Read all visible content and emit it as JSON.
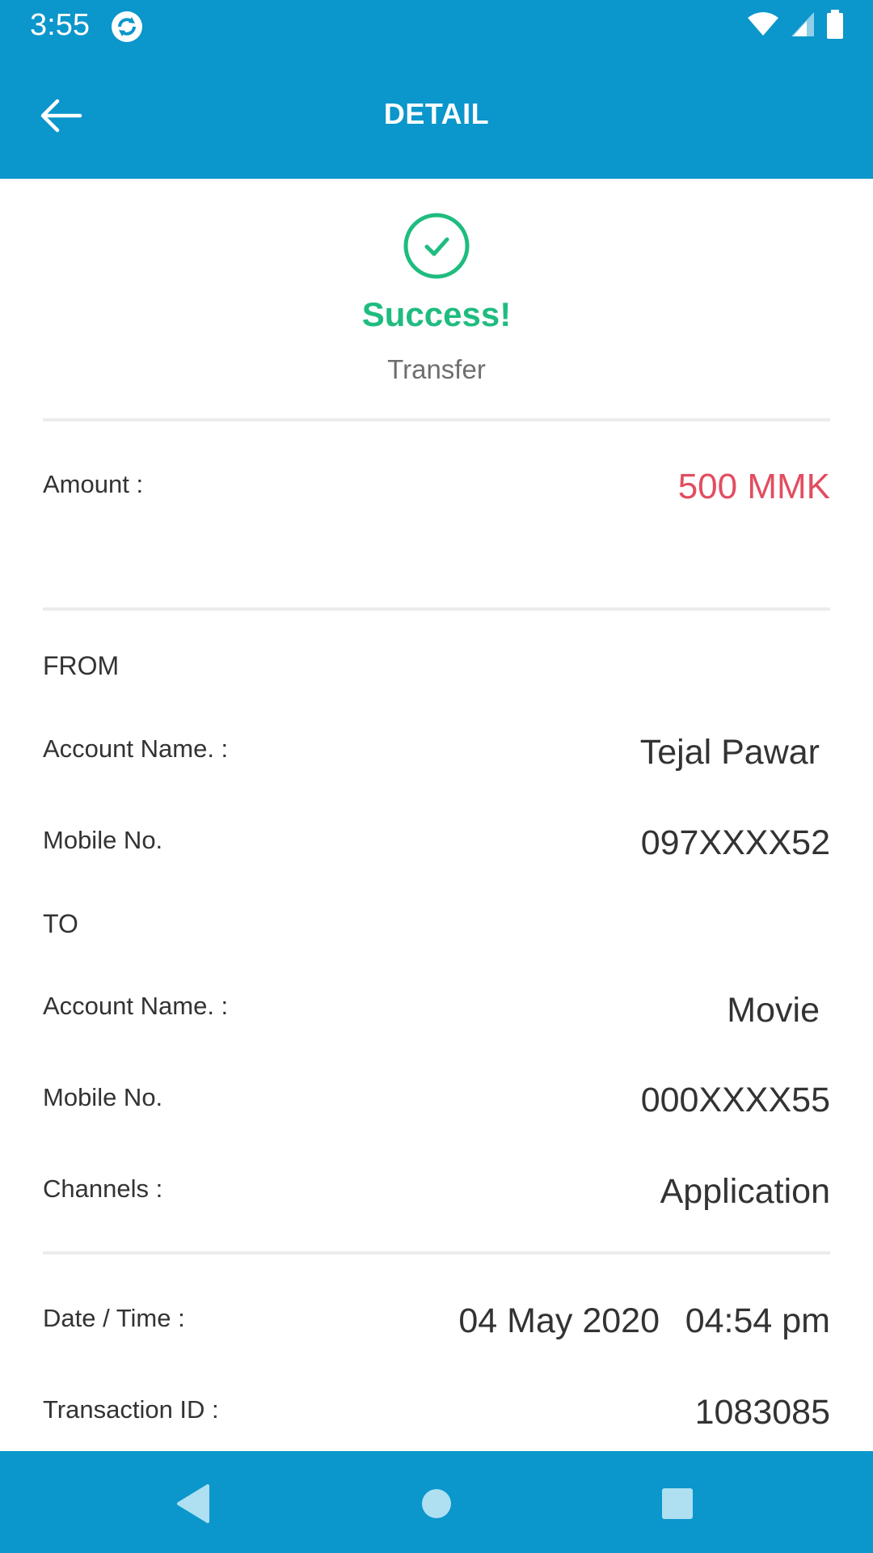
{
  "status_bar": {
    "time": "3:55",
    "icons": [
      "app-sync-icon",
      "wifi-icon",
      "signal-icon",
      "battery-icon"
    ]
  },
  "app_bar": {
    "back_icon": "arrow-left-icon",
    "title": "DETAIL"
  },
  "result": {
    "icon": "check-circle-icon",
    "title": "Success!",
    "subtitle": "Transfer"
  },
  "amount": {
    "label": "Amount :",
    "value": "500 MMK"
  },
  "from": {
    "heading": "FROM",
    "account_name_label": "Account Name. :",
    "account_name_value": "Tejal Pawar",
    "mobile_label": "Mobile No.",
    "mobile_value": "097XXXX52"
  },
  "to": {
    "heading": "TO",
    "account_name_label": "Account Name. :",
    "account_name_value": "Movie",
    "mobile_label": "Mobile No.",
    "mobile_value": "000XXXX55"
  },
  "channels": {
    "label": "Channels :",
    "value": "Application"
  },
  "datetime": {
    "label": "Date / Time :",
    "date": "04 May 2020",
    "time": "04:54 pm"
  },
  "transaction": {
    "label": "Transaction ID :",
    "value": "1083085"
  },
  "colors": {
    "primary": "#0b96cc",
    "success": "#1fbc7f",
    "amount": "#e24d60"
  },
  "nav_bar": {
    "icons": [
      "back-triangle-icon",
      "home-circle-icon",
      "recents-square-icon"
    ]
  }
}
